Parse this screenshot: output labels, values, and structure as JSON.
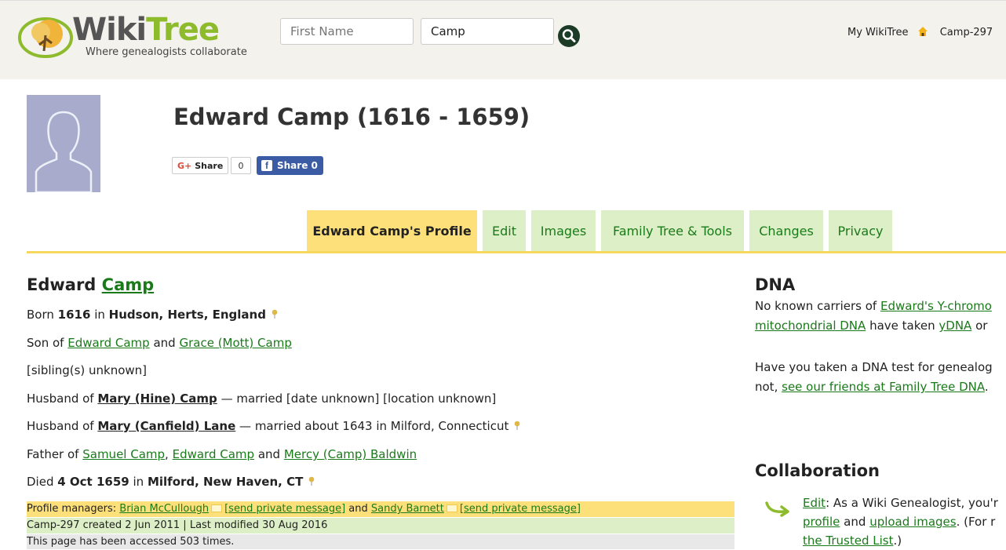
{
  "header": {
    "brand_left": "Wiki",
    "brand_right": "Tree",
    "tagline": "Where genealogists collaborate",
    "first_name_placeholder": "First Name",
    "last_name_value": "Camp",
    "my_wikitree": "My WikiTree",
    "user_id": "Camp-297"
  },
  "profile": {
    "title": "Edward Camp (1616 - 1659)",
    "gplus_label": "Share",
    "gplus_count": "0",
    "fb_label": "Share 0"
  },
  "tabs": [
    {
      "label": "Edward Camp's Profile"
    },
    {
      "label": "Edit"
    },
    {
      "label": "Images"
    },
    {
      "label": "Family Tree & Tools"
    },
    {
      "label": "Changes"
    },
    {
      "label": "Privacy"
    }
  ],
  "bio": {
    "first_name": "Edward",
    "surname": "Camp",
    "born_prefix": "Born",
    "born_year": "1616",
    "born_in": "in",
    "born_place": "Hudson, Herts, England",
    "son_of": "Son of",
    "father": "Edward Camp",
    "and": "and",
    "mother": "Grace (Mott) Camp",
    "siblings": "[sibling(s) unknown]",
    "husband_of": "Husband of",
    "spouse1": "Mary (Hine) Camp",
    "spouse1_detail": "— married [date unknown] [location unknown]",
    "spouse2": "Mary (Canfield) Lane",
    "spouse2_detail": "— married about 1643 in Milford, Connecticut",
    "father_of": "Father of",
    "child1": "Samuel Camp",
    "comma": ",",
    "child2": "Edward Camp",
    "child3": "Mercy (Camp) Baldwin",
    "died_prefix": "Died",
    "died_date": "4 Oct 1659",
    "died_in": "in",
    "died_place": "Milford, New Haven, CT"
  },
  "managers": {
    "prefix": "Profile managers:",
    "manager1": "Brian McCullough",
    "pm1": "[send private message]",
    "and": "and",
    "manager2": "Sandy Barnett",
    "pm2": "[send private message]",
    "created": "Camp-297 created 2 Jun 2011 | Last modified 30 Aug 2016",
    "accessed": "This page has been accessed 503 times."
  },
  "dna": {
    "heading": "DNA",
    "line1_text": "No known carriers of",
    "line1_link": "Edward's Y-chromo",
    "line2_link": "mitochondrial DNA",
    "line2_text": "have taken",
    "line2_link2": "yDNA",
    "line2_tail": "or",
    "line3": "Have you taken a DNA test for genealog",
    "line4_text": "not,",
    "line4_link": "see our friends at Family Tree DNA",
    "line4_tail": "."
  },
  "collab": {
    "heading": "Collaboration",
    "edit_link": "Edit",
    "line1_tail": ": As a Wiki Genealogist, you'r",
    "profile_link": "profile",
    "and_text": "and",
    "upload_link": "upload images",
    "line2_tail": ". (For r",
    "trusted_link": "the Trusted List",
    "line3_tail": ".)"
  },
  "colors": {
    "topbar": "#f3f2ed",
    "tab_active": "#fee07a",
    "tab_inactive": "#ddefc6",
    "link": "#1a7a1a",
    "mgr_yellow": "#fee07a",
    "mgr_green": "#ddefc6",
    "mgr_gray": "#e8e8e8"
  }
}
